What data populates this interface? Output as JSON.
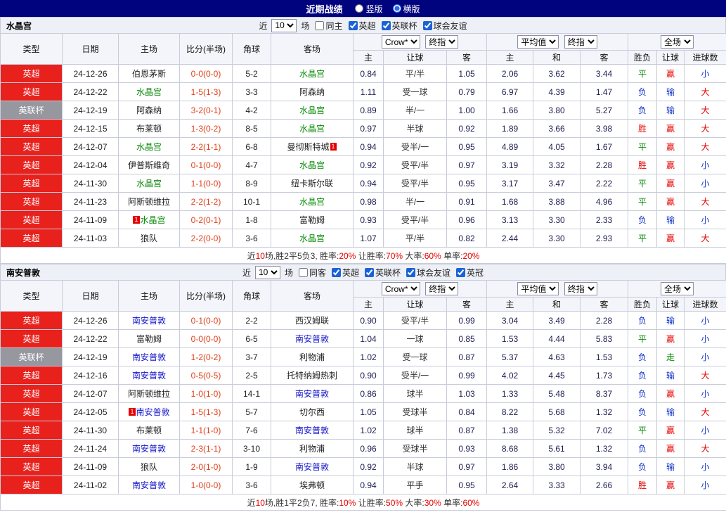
{
  "topbar": {
    "title": "近期战绩",
    "radios": {
      "vertical": "竖版",
      "horizontal": "横版",
      "selected": "横版"
    }
  },
  "table_header": {
    "col_type": "类型",
    "col_date": "日期",
    "col_home": "主场",
    "col_score": "比分(半场)",
    "col_corner": "角球",
    "col_away": "客场",
    "crow_select": "Crow*",
    "final_select": "终指",
    "avg_select": "平均值",
    "full_select": "全场",
    "sub_home": "主",
    "sub_handicap": "让球",
    "sub_away": "客",
    "sub_avg_home": "主",
    "sub_draw": "和",
    "sub_avg_away": "客",
    "sub_result": "胜负",
    "sub_handicap_result": "让球",
    "sub_goals": "进球数"
  },
  "sections": [
    {
      "team": "水晶宫",
      "filter": {
        "near_label": "近",
        "count": "10",
        "games_label": "场",
        "checkboxes": [
          {
            "label": "同主",
            "checked": false
          },
          {
            "label": "英超",
            "checked": true
          },
          {
            "label": "英联杯",
            "checked": true
          },
          {
            "label": "球会友谊",
            "checked": true
          }
        ]
      },
      "rows": [
        {
          "type": "英超",
          "type_color": "red",
          "date": "24-12-26",
          "home": "伯恩茅斯",
          "home_color": "dark",
          "home_badge": "",
          "home_badge_pos": "",
          "score": "0-0(0-0)",
          "corner": "5-2",
          "away": "水晶宫",
          "away_color": "green",
          "away_badge": "",
          "away_badge_pos": "",
          "crow": [
            "0.84",
            "平/半",
            "1.05"
          ],
          "avg": [
            "2.06",
            "3.62",
            "3.44"
          ],
          "result": "平",
          "handicap_result": "赢",
          "goals": "小"
        },
        {
          "type": "英超",
          "type_color": "red",
          "date": "24-12-22",
          "home": "水晶宫",
          "home_color": "green",
          "home_badge": "",
          "home_badge_pos": "",
          "score": "1-5(1-3)",
          "corner": "3-3",
          "away": "阿森纳",
          "away_color": "dark",
          "away_badge": "",
          "away_badge_pos": "",
          "crow": [
            "1.11",
            "受一球",
            "0.79"
          ],
          "avg": [
            "6.97",
            "4.39",
            "1.47"
          ],
          "result": "负",
          "handicap_result": "输",
          "goals": "大"
        },
        {
          "type": "英联杯",
          "type_color": "gray",
          "date": "24-12-19",
          "home": "阿森纳",
          "home_color": "dark",
          "home_badge": "",
          "home_badge_pos": "",
          "score": "3-2(0-1)",
          "corner": "4-2",
          "away": "水晶宫",
          "away_color": "green",
          "away_badge": "",
          "away_badge_pos": "",
          "crow": [
            "0.89",
            "半/一",
            "1.00"
          ],
          "avg": [
            "1.66",
            "3.80",
            "5.27"
          ],
          "result": "负",
          "handicap_result": "输",
          "goals": "大"
        },
        {
          "type": "英超",
          "type_color": "red",
          "date": "24-12-15",
          "home": "布莱顿",
          "home_color": "dark",
          "home_badge": "",
          "home_badge_pos": "",
          "score": "1-3(0-2)",
          "corner": "8-5",
          "away": "水晶宫",
          "away_color": "green",
          "away_badge": "",
          "away_badge_pos": "",
          "crow": [
            "0.97",
            "半球",
            "0.92"
          ],
          "avg": [
            "1.89",
            "3.66",
            "3.98"
          ],
          "result": "胜",
          "handicap_result": "赢",
          "goals": "大"
        },
        {
          "type": "英超",
          "type_color": "red",
          "date": "24-12-07",
          "home": "水晶宫",
          "home_color": "green",
          "home_badge": "",
          "home_badge_pos": "",
          "score": "2-2(1-1)",
          "corner": "6-8",
          "away": "曼彻斯特城",
          "away_color": "dark",
          "away_badge": "1",
          "away_badge_pos": "after",
          "crow": [
            "0.94",
            "受半/一",
            "0.95"
          ],
          "avg": [
            "4.89",
            "4.05",
            "1.67"
          ],
          "result": "平",
          "handicap_result": "赢",
          "goals": "大"
        },
        {
          "type": "英超",
          "type_color": "red",
          "date": "24-12-04",
          "home": "伊普斯维奇",
          "home_color": "dark",
          "home_badge": "",
          "home_badge_pos": "",
          "score": "0-1(0-0)",
          "corner": "4-7",
          "away": "水晶宫",
          "away_color": "green",
          "away_badge": "",
          "away_badge_pos": "",
          "crow": [
            "0.92",
            "受平/半",
            "0.97"
          ],
          "avg": [
            "3.19",
            "3.32",
            "2.28"
          ],
          "result": "胜",
          "handicap_result": "赢",
          "goals": "小"
        },
        {
          "type": "英超",
          "type_color": "red",
          "date": "24-11-30",
          "home": "水晶宫",
          "home_color": "green",
          "home_badge": "",
          "home_badge_pos": "",
          "score": "1-1(0-0)",
          "corner": "8-9",
          "away": "纽卡斯尔联",
          "away_color": "dark",
          "away_badge": "",
          "away_badge_pos": "",
          "crow": [
            "0.94",
            "受平/半",
            "0.95"
          ],
          "avg": [
            "3.17",
            "3.47",
            "2.22"
          ],
          "result": "平",
          "handicap_result": "赢",
          "goals": "小"
        },
        {
          "type": "英超",
          "type_color": "red",
          "date": "24-11-23",
          "home": "阿斯顿维拉",
          "home_color": "dark",
          "home_badge": "",
          "home_badge_pos": "",
          "score": "2-2(1-2)",
          "corner": "10-1",
          "away": "水晶宫",
          "away_color": "green",
          "away_badge": "",
          "away_badge_pos": "",
          "crow": [
            "0.98",
            "半/一",
            "0.91"
          ],
          "avg": [
            "1.68",
            "3.88",
            "4.96"
          ],
          "result": "平",
          "handicap_result": "赢",
          "goals": "大"
        },
        {
          "type": "英超",
          "type_color": "red",
          "date": "24-11-09",
          "home": "水晶宫",
          "home_color": "green",
          "home_badge": "1",
          "home_badge_pos": "before",
          "score": "0-2(0-1)",
          "corner": "1-8",
          "away": "富勒姆",
          "away_color": "dark",
          "away_badge": "",
          "away_badge_pos": "",
          "crow": [
            "0.93",
            "受平/半",
            "0.96"
          ],
          "avg": [
            "3.13",
            "3.30",
            "2.33"
          ],
          "result": "负",
          "handicap_result": "输",
          "goals": "小"
        },
        {
          "type": "英超",
          "type_color": "red",
          "date": "24-11-03",
          "home": "狼队",
          "home_color": "dark",
          "home_badge": "",
          "home_badge_pos": "",
          "score": "2-2(0-0)",
          "corner": "3-6",
          "away": "水晶宫",
          "away_color": "green",
          "away_badge": "",
          "away_badge_pos": "",
          "crow": [
            "1.07",
            "平/半",
            "0.82"
          ],
          "avg": [
            "2.44",
            "3.30",
            "2.93"
          ],
          "result": "平",
          "handicap_result": "赢",
          "goals": "大"
        }
      ],
      "summary": [
        {
          "text": "近",
          "red": false
        },
        {
          "text": "10",
          "red": true
        },
        {
          "text": "场,胜2平5负3, 胜率:",
          "red": false
        },
        {
          "text": "20%",
          "red": true
        },
        {
          "text": " 让胜率:",
          "red": false
        },
        {
          "text": "70%",
          "red": true
        },
        {
          "text": " 大率:",
          "red": false
        },
        {
          "text": "60%",
          "red": true
        },
        {
          "text": " 单率:",
          "red": false
        },
        {
          "text": "20%",
          "red": true
        }
      ]
    },
    {
      "team": "南安普敦",
      "filter": {
        "near_label": "近",
        "count": "10",
        "games_label": "场",
        "checkboxes": [
          {
            "label": "同客",
            "checked": false
          },
          {
            "label": "英超",
            "checked": true
          },
          {
            "label": "英联杯",
            "checked": true
          },
          {
            "label": "球会友谊",
            "checked": true
          },
          {
            "label": "英冠",
            "checked": true
          }
        ]
      },
      "rows": [
        {
          "type": "英超",
          "type_color": "red",
          "date": "24-12-26",
          "home": "南安普敦",
          "home_color": "blue",
          "home_badge": "",
          "home_badge_pos": "",
          "score": "0-1(0-0)",
          "corner": "2-2",
          "away": "西汉姆联",
          "away_color": "dark",
          "away_badge": "",
          "away_badge_pos": "",
          "crow": [
            "0.90",
            "受平/半",
            "0.99"
          ],
          "avg": [
            "3.04",
            "3.49",
            "2.28"
          ],
          "result": "负",
          "handicap_result": "输",
          "goals": "小"
        },
        {
          "type": "英超",
          "type_color": "red",
          "date": "24-12-22",
          "home": "富勒姆",
          "home_color": "dark",
          "home_badge": "",
          "home_badge_pos": "",
          "score": "0-0(0-0)",
          "corner": "6-5",
          "away": "南安普敦",
          "away_color": "blue",
          "away_badge": "",
          "away_badge_pos": "",
          "crow": [
            "1.04",
            "一球",
            "0.85"
          ],
          "avg": [
            "1.53",
            "4.44",
            "5.83"
          ],
          "result": "平",
          "handicap_result": "赢",
          "goals": "小"
        },
        {
          "type": "英联杯",
          "type_color": "gray",
          "date": "24-12-19",
          "home": "南安普敦",
          "home_color": "blue",
          "home_badge": "",
          "home_badge_pos": "",
          "score": "1-2(0-2)",
          "corner": "3-7",
          "away": "利物浦",
          "away_color": "dark",
          "away_badge": "",
          "away_badge_pos": "",
          "crow": [
            "1.02",
            "受一球",
            "0.87"
          ],
          "avg": [
            "5.37",
            "4.63",
            "1.53"
          ],
          "result": "负",
          "handicap_result": "走",
          "goals": "小"
        },
        {
          "type": "英超",
          "type_color": "red",
          "date": "24-12-16",
          "home": "南安普敦",
          "home_color": "blue",
          "home_badge": "",
          "home_badge_pos": "",
          "score": "0-5(0-5)",
          "corner": "2-5",
          "away": "托特纳姆热刺",
          "away_color": "dark",
          "away_badge": "",
          "away_badge_pos": "",
          "crow": [
            "0.90",
            "受半/一",
            "0.99"
          ],
          "avg": [
            "4.02",
            "4.45",
            "1.73"
          ],
          "result": "负",
          "handicap_result": "输",
          "goals": "大"
        },
        {
          "type": "英超",
          "type_color": "red",
          "date": "24-12-07",
          "home": "阿斯顿维拉",
          "home_color": "dark",
          "home_badge": "",
          "home_badge_pos": "",
          "score": "1-0(1-0)",
          "corner": "14-1",
          "away": "南安普敦",
          "away_color": "blue",
          "away_badge": "",
          "away_badge_pos": "",
          "crow": [
            "0.86",
            "球半",
            "1.03"
          ],
          "avg": [
            "1.33",
            "5.48",
            "8.37"
          ],
          "result": "负",
          "handicap_result": "赢",
          "goals": "小"
        },
        {
          "type": "英超",
          "type_color": "red",
          "date": "24-12-05",
          "home": "南安普敦",
          "home_color": "blue",
          "home_badge": "1",
          "home_badge_pos": "before",
          "score": "1-5(1-3)",
          "corner": "5-7",
          "away": "切尔西",
          "away_color": "dark",
          "away_badge": "",
          "away_badge_pos": "",
          "crow": [
            "1.05",
            "受球半",
            "0.84"
          ],
          "avg": [
            "8.22",
            "5.68",
            "1.32"
          ],
          "result": "负",
          "handicap_result": "输",
          "goals": "大"
        },
        {
          "type": "英超",
          "type_color": "red",
          "date": "24-11-30",
          "home": "布莱顿",
          "home_color": "dark",
          "home_badge": "",
          "home_badge_pos": "",
          "score": "1-1(1-0)",
          "corner": "7-6",
          "away": "南安普敦",
          "away_color": "blue",
          "away_badge": "",
          "away_badge_pos": "",
          "crow": [
            "1.02",
            "球半",
            "0.87"
          ],
          "avg": [
            "1.38",
            "5.32",
            "7.02"
          ],
          "result": "平",
          "handicap_result": "赢",
          "goals": "小"
        },
        {
          "type": "英超",
          "type_color": "red",
          "date": "24-11-24",
          "home": "南安普敦",
          "home_color": "blue",
          "home_badge": "",
          "home_badge_pos": "",
          "score": "2-3(1-1)",
          "corner": "3-10",
          "away": "利物浦",
          "away_color": "dark",
          "away_badge": "",
          "away_badge_pos": "",
          "crow": [
            "0.96",
            "受球半",
            "0.93"
          ],
          "avg": [
            "8.68",
            "5.61",
            "1.32"
          ],
          "result": "负",
          "handicap_result": "赢",
          "goals": "大"
        },
        {
          "type": "英超",
          "type_color": "red",
          "date": "24-11-09",
          "home": "狼队",
          "home_color": "dark",
          "home_badge": "",
          "home_badge_pos": "",
          "score": "2-0(1-0)",
          "corner": "1-9",
          "away": "南安普敦",
          "away_color": "blue",
          "away_badge": "",
          "away_badge_pos": "",
          "crow": [
            "0.92",
            "半球",
            "0.97"
          ],
          "avg": [
            "1.86",
            "3.80",
            "3.94"
          ],
          "result": "负",
          "handicap_result": "输",
          "goals": "小"
        },
        {
          "type": "英超",
          "type_color": "red",
          "date": "24-11-02",
          "home": "南安普敦",
          "home_color": "blue",
          "home_badge": "",
          "home_badge_pos": "",
          "score": "1-0(0-0)",
          "corner": "3-6",
          "away": "埃弗顿",
          "away_color": "dark",
          "away_badge": "",
          "away_badge_pos": "",
          "crow": [
            "0.94",
            "平手",
            "0.95"
          ],
          "avg": [
            "2.64",
            "3.33",
            "2.66"
          ],
          "result": "胜",
          "handicap_result": "赢",
          "goals": "小"
        }
      ],
      "summary": [
        {
          "text": "近",
          "red": false
        },
        {
          "text": "10",
          "red": true
        },
        {
          "text": "场,胜1平2负7, 胜率:",
          "red": false
        },
        {
          "text": "10%",
          "red": true
        },
        {
          "text": " 让胜率:",
          "red": false
        },
        {
          "text": "50%",
          "red": true
        },
        {
          "text": " 大率:",
          "red": false
        },
        {
          "text": "30%",
          "red": true
        },
        {
          "text": " 单率:",
          "red": false
        },
        {
          "text": "60%",
          "red": true
        }
      ]
    }
  ]
}
